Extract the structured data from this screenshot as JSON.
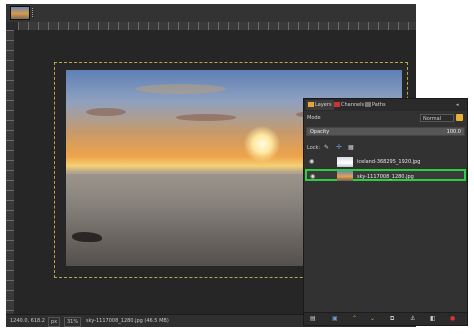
{
  "statusbar": {
    "coords": "1240.0, 618.2",
    "unit": "px",
    "zoom": "31%",
    "image_info": "sky-1117008_1280.jpg (46.5 MB)"
  },
  "layers_dock": {
    "tabs": [
      {
        "label": "Layers",
        "icon": "layers-icon",
        "color": "#e8a33a"
      },
      {
        "label": "Channels",
        "icon": "channels-icon",
        "color": "#cc3333"
      },
      {
        "label": "Paths",
        "icon": "paths-icon",
        "color": "#777777"
      }
    ],
    "mode_label": "Mode",
    "mode_value": "Normal",
    "opacity_label": "Opacity",
    "opacity_value": "100.0",
    "lock_label": "Lock:",
    "layers": [
      {
        "name": "iceland-368295_1920.jpg",
        "visible": true,
        "selected": false
      },
      {
        "name": "sky-1117008_1280.jpg",
        "visible": true,
        "selected": true
      }
    ]
  },
  "colors": {
    "selection_highlight": "#2ecc40",
    "canvas_bg": "#262626",
    "boundary": "#b5a94a"
  }
}
